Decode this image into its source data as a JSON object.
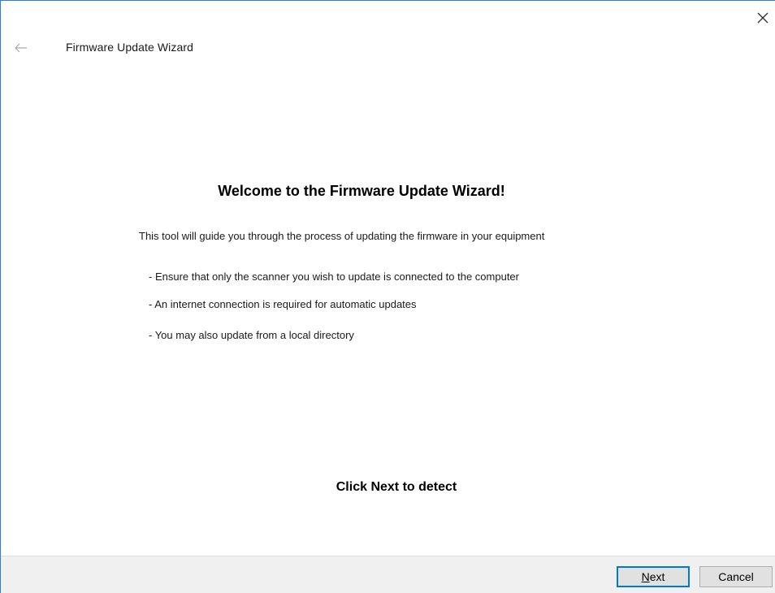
{
  "window": {
    "title": "Firmware Update Wizard"
  },
  "content": {
    "heading": "Welcome to the Firmware Update Wizard!",
    "intro": "This tool will guide you through the process of updating the firmware in your equipment",
    "bullets": [
      "-  Ensure that only the scanner you wish to update is connected to the computer",
      "-  An internet connection is required for automatic updates",
      "-  You may also update from a local directory"
    ],
    "prompt": "Click Next to detect"
  },
  "footer": {
    "next_mnemonic": "N",
    "next_rest": "ext",
    "cancel_label": "Cancel"
  },
  "icons": {
    "back": "back-arrow-icon",
    "close": "close-icon"
  },
  "colors": {
    "window_border": "#2b7fd4",
    "footer_bg": "#f0f0f0",
    "default_button_border": "#0078d7",
    "button_bg": "#e1e1e1"
  }
}
